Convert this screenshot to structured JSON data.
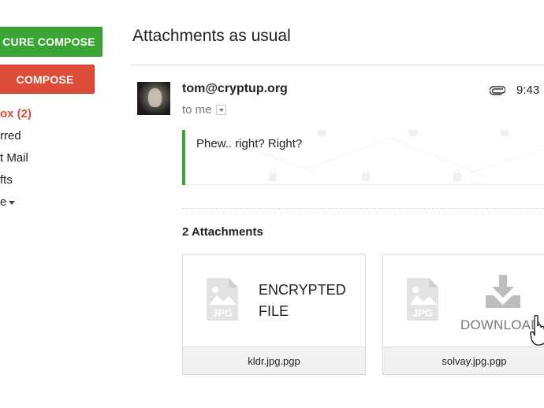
{
  "sidebar": {
    "secure_compose_label": "CURE COMPOSE",
    "compose_label": "COMPOSE",
    "items": [
      {
        "label": "ox (2)"
      },
      {
        "label": "rred"
      },
      {
        "label": "t Mail"
      },
      {
        "label": "fts"
      },
      {
        "label": "e"
      }
    ]
  },
  "thread": {
    "subject": "Attachments as usual"
  },
  "message": {
    "sender": "tom@cryptup.org",
    "recipient": "to me",
    "time": "9:43",
    "body": "Phew.. right? Right?",
    "avatar_icon": "avatar-photo",
    "attachment_indicator_icon": "paperclip-icon",
    "accent_color": "#3aa435"
  },
  "attachments": {
    "count_label": "2 Attachments",
    "items": [
      {
        "filename": "kldr.jpg.pgp",
        "status": "ENCRYPTED FILE",
        "icon": "jpg-file-icon"
      },
      {
        "filename": "solvay.jpg.pgp",
        "action": "DOWNLOAD",
        "icon": "jpg-file-icon",
        "action_icon": "download-icon"
      }
    ]
  },
  "colors": {
    "secure_compose": "#3aa435",
    "compose": "#dd4b39",
    "inbox_active": "#dd4b39"
  }
}
